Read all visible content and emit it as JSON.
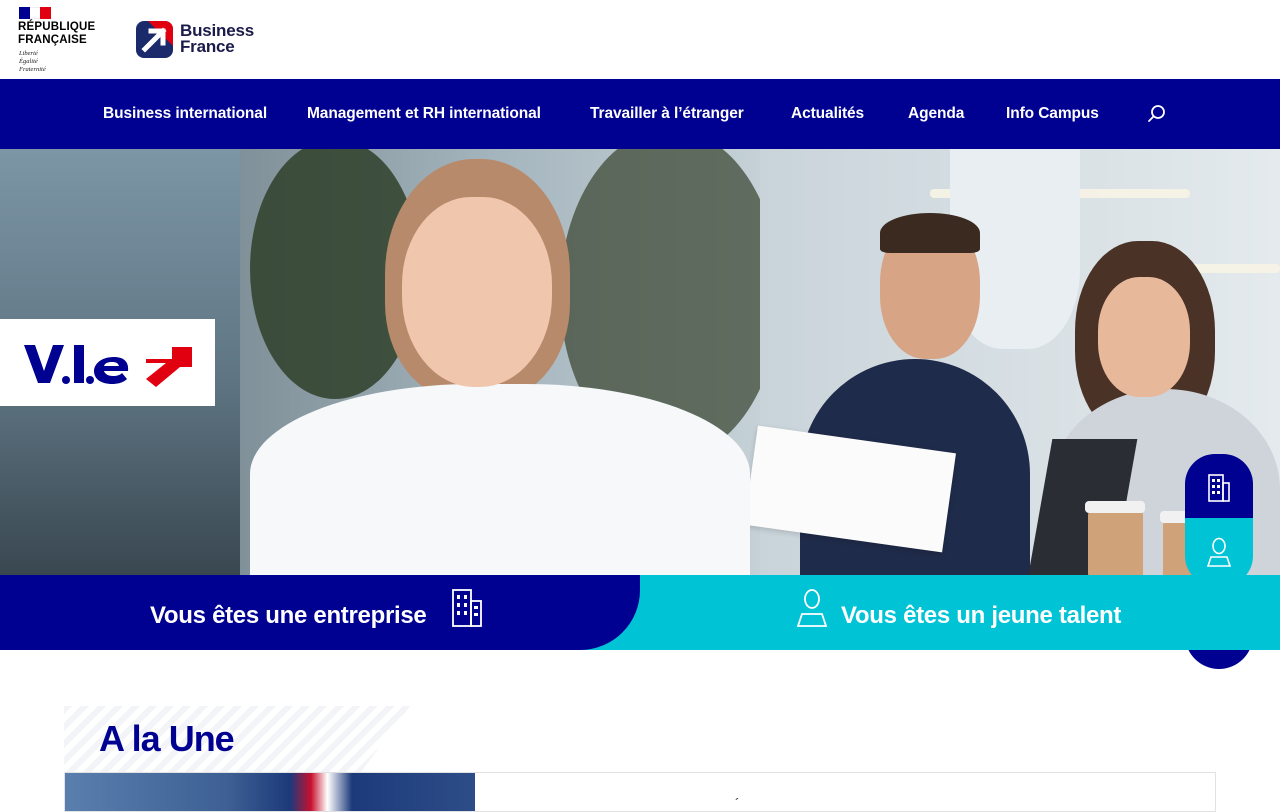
{
  "header": {
    "rf_logo": {
      "title": "RÉPUBLIQUE\nFRANÇAISE",
      "motto": "Liberté\nÉgalité\nFraternité",
      "flag_colors": [
        "#000091",
        "#ffffff",
        "#e1000f"
      ]
    },
    "brand_logo": {
      "text": "Business\nFrance",
      "colors": {
        "blue": "#1b2a6b",
        "red": "#e1000f"
      }
    }
  },
  "nav": {
    "items": [
      {
        "label": "Business international"
      },
      {
        "label": "Management et RH international"
      },
      {
        "label": "Travailler à l’étranger"
      },
      {
        "label": "Actualités"
      },
      {
        "label": "Agenda"
      },
      {
        "label": "Info Campus"
      }
    ],
    "search_icon": "search-icon"
  },
  "hero": {
    "badge_logo": "V.I.E",
    "side_buttons": [
      {
        "icon": "building-icon"
      },
      {
        "icon": "person-icon"
      },
      {
        "icon": "mail-icon"
      }
    ]
  },
  "cta": {
    "company_label": "Vous êtes une entreprise",
    "company_icon": "building-icon",
    "talent_label": "Vous êtes un jeune talent",
    "talent_icon": "person-icon"
  },
  "news": {
    "section_title": "A la Une"
  },
  "colors": {
    "primary": "#000091",
    "accent": "#00c3d6",
    "red": "#e1000f"
  }
}
